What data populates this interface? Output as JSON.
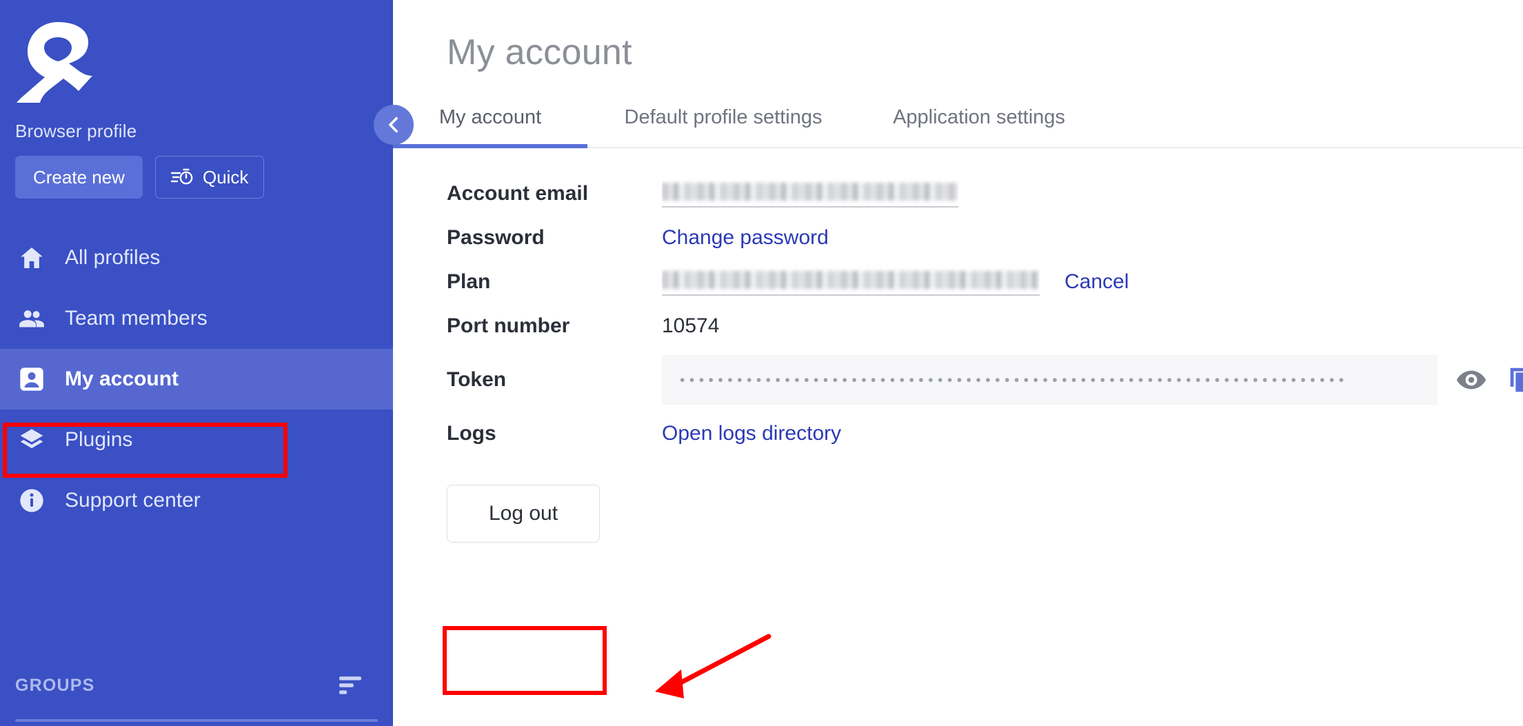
{
  "sidebar": {
    "logo_icon": "adspower-person-logo",
    "browser_profile_label": "Browser profile",
    "create_new_label": "Create new",
    "quick_label": "Quick",
    "quick_icon": "stopwatch-speed-icon",
    "items": [
      {
        "label": "All profiles",
        "icon": "home-icon",
        "active": false
      },
      {
        "label": "Team members",
        "icon": "people-icon",
        "active": false
      },
      {
        "label": "My account",
        "icon": "account-icon",
        "active": true
      },
      {
        "label": "Plugins",
        "icon": "layers-icon",
        "active": false
      },
      {
        "label": "Support center",
        "icon": "info-icon",
        "active": false
      }
    ],
    "groups_label": "GROUPS",
    "groups_sort_icon": "sort-lines-icon",
    "collapse_icon": "chevron-left-icon"
  },
  "main": {
    "page_title": "My account",
    "tabs": [
      {
        "label": "My account",
        "active": true
      },
      {
        "label": "Default profile settings",
        "active": false
      },
      {
        "label": "Application settings",
        "active": false
      }
    ],
    "rows": {
      "account_email_label": "Account email",
      "account_email_value": "",
      "password_label": "Password",
      "change_password_link": "Change password",
      "plan_label": "Plan",
      "plan_value": "",
      "cancel_link": "Cancel",
      "port_label": "Port number",
      "port_value": "10574",
      "token_label": "Token",
      "token_masked": "••••••••••••••••••••••••••••••••••••••••••••••••••••••••••••••••••••••",
      "token_eye_icon": "eye-icon",
      "token_copy_icon": "copy-icon",
      "logs_label": "Logs",
      "open_logs_link": "Open logs directory"
    },
    "logout_label": "Log out"
  },
  "annotations": {
    "highlight_color": "#ff0000",
    "boxes": [
      "my-account-nav-item",
      "log-out-button"
    ],
    "arrow": "points-left-to-log-out-button"
  },
  "colors": {
    "sidebar_bg": "#3a50c4",
    "sidebar_active": "#5668d0",
    "accent_blue": "#5a6fd8",
    "link_blue": "#2b39b5",
    "annotation_red": "#ff0000"
  }
}
